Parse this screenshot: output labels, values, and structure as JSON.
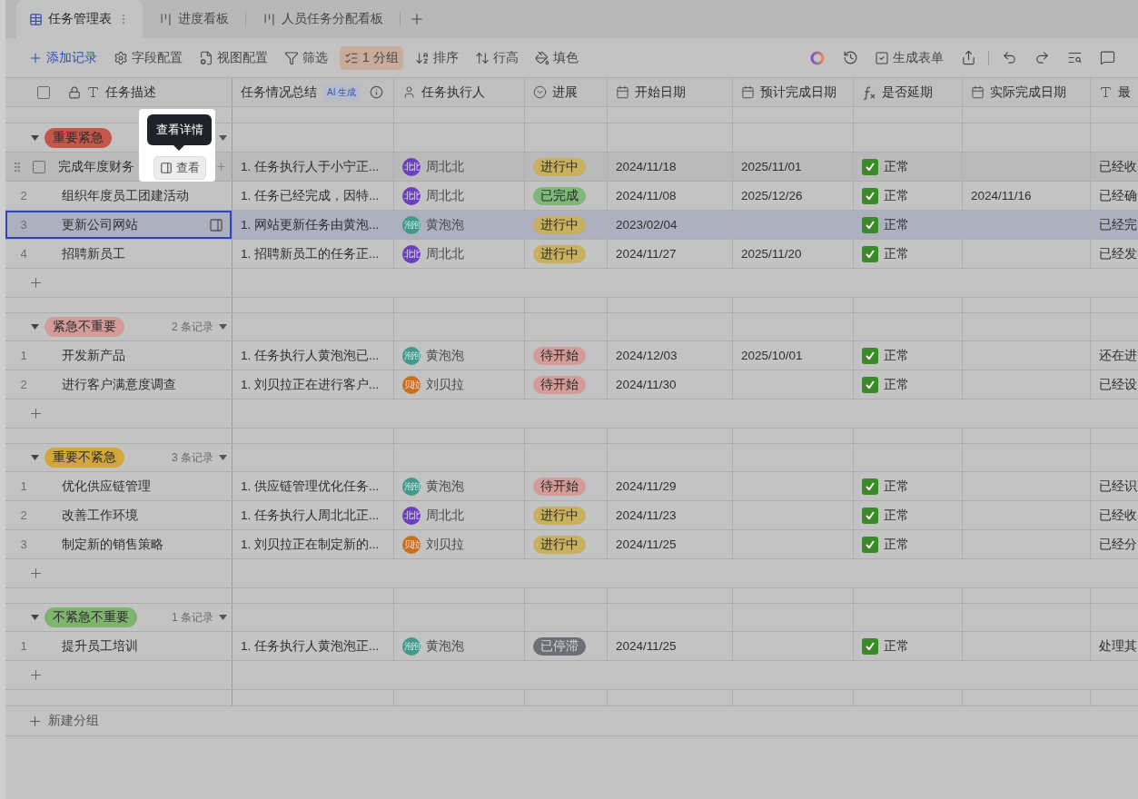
{
  "tabs": [
    {
      "label": "任务管理表",
      "kind": "table",
      "selected": true
    },
    {
      "label": "进度看板",
      "kind": "kanban",
      "selected": false
    },
    {
      "label": "人员任务分配看板",
      "kind": "kanban",
      "selected": false
    }
  ],
  "toolbar": [
    {
      "label": "添加记录",
      "kind": "add",
      "active": false
    },
    {
      "label": "字段配置",
      "kind": "gear",
      "active": false
    },
    {
      "label": "视图配置",
      "kind": "view",
      "active": false
    },
    {
      "label": "筛选",
      "kind": "filter",
      "active": false
    },
    {
      "label": "1 分组",
      "kind": "group",
      "active": true
    },
    {
      "label": "排序",
      "kind": "sort",
      "active": false
    },
    {
      "label": "行高",
      "kind": "height",
      "active": false
    },
    {
      "label": "填色",
      "kind": "paint",
      "active": false
    }
  ],
  "toolbar_right": [
    {
      "kind": "logo"
    },
    {
      "kind": "history"
    },
    {
      "kind": "form",
      "label": "生成表单"
    },
    {
      "kind": "share"
    },
    {
      "kind": "divider"
    },
    {
      "kind": "undo"
    },
    {
      "kind": "redo"
    },
    {
      "kind": "find"
    },
    {
      "kind": "comment"
    }
  ],
  "columns": [
    {
      "label": "任务描述",
      "kind": "text"
    },
    {
      "label": "任务情况总结",
      "kind": "ai",
      "badge": "AI 生成"
    },
    {
      "label": "任务执行人",
      "kind": "person"
    },
    {
      "label": "进展",
      "kind": "select"
    },
    {
      "label": "开始日期",
      "kind": "date"
    },
    {
      "label": "预计完成日期",
      "kind": "date"
    },
    {
      "label": "是否延期",
      "kind": "formula"
    },
    {
      "label": "实际完成日期",
      "kind": "date"
    },
    {
      "label": "最",
      "kind": "text"
    }
  ],
  "select_all": {
    "checked": false
  },
  "tooltip": "查看详情",
  "view_button": "查看",
  "groups": [
    {
      "tag": "重要紧急",
      "color": "#c4574b",
      "rows": [
        {
          "index": null,
          "hovered": true,
          "checked": false,
          "selected": false,
          "name": "完成年度财务",
          "summary": "1. 任务执行人于小宁正...",
          "assignee": {
            "name": "周北北",
            "initials": "北北",
            "color": "#6a3fc0"
          },
          "status": {
            "label": "进行中",
            "color": "#c8b060"
          },
          "start": "2024/11/18",
          "planned": "2025/11/01",
          "delay": "正常",
          "actual": "",
          "latest": "已经收"
        },
        {
          "index": "2",
          "hovered": false,
          "selected": false,
          "name": "组织年度员工团建活动",
          "summary": "1. 任务已经完成，因特...",
          "assignee": {
            "name": "周北北",
            "initials": "北北",
            "color": "#6a3fc0"
          },
          "status": {
            "label": "已完成",
            "color": "#7fb679"
          },
          "start": "2024/11/08",
          "planned": "2025/12/26",
          "delay": "正常",
          "actual": "2024/11/16",
          "latest": "已经确"
        },
        {
          "index": "3",
          "hovered": false,
          "selected": true,
          "name": "更新公司网站",
          "summary": "1. 网站更新任务由黄泡...",
          "assignee": {
            "name": "黄泡泡",
            "initials": "泡泡",
            "color": "#3f9a8c"
          },
          "status": {
            "label": "进行中",
            "color": "#c8b060"
          },
          "start": "2023/02/04",
          "planned": "",
          "delay": "正常",
          "actual": "",
          "latest": "已经完"
        },
        {
          "index": "4",
          "hovered": false,
          "selected": false,
          "name": "招聘新员工",
          "summary": "1. 招聘新员工的任务正...",
          "assignee": {
            "name": "周北北",
            "initials": "北北",
            "color": "#6a3fc0"
          },
          "status": {
            "label": "进行中",
            "color": "#c8b060"
          },
          "start": "2024/11/27",
          "planned": "2025/11/20",
          "delay": "正常",
          "actual": "",
          "latest": "已经发"
        }
      ]
    },
    {
      "tag": "紧急不重要",
      "color": "#d39c99",
      "count": "2 条记录",
      "rows": [
        {
          "index": "1",
          "hovered": false,
          "selected": false,
          "name": "开发新产品",
          "summary": "1. 任务执行人黄泡泡已...",
          "assignee": {
            "name": "黄泡泡",
            "initials": "泡泡",
            "color": "#3f9a8c"
          },
          "status": {
            "label": "待开始",
            "color": "#d39c99"
          },
          "start": "2024/12/03",
          "planned": "2025/10/01",
          "delay": "正常",
          "actual": "",
          "latest": "还在进"
        },
        {
          "index": "2",
          "hovered": false,
          "selected": false,
          "name": "进行客户满意度调查",
          "summary": "1. 刘贝拉正在进行客户...",
          "assignee": {
            "name": "刘贝拉",
            "initials": "贝拉",
            "color": "#c9701f"
          },
          "status": {
            "label": "待开始",
            "color": "#d39c99"
          },
          "start": "2024/11/30",
          "planned": "",
          "delay": "正常",
          "actual": "",
          "latest": "已经设"
        }
      ]
    },
    {
      "tag": "重要不紧急",
      "color": "#d3a63a",
      "count": "3 条记录",
      "rows": [
        {
          "index": "1",
          "hovered": false,
          "selected": false,
          "name": "优化供应链管理",
          "summary": "1. 供应链管理优化任务...",
          "assignee": {
            "name": "黄泡泡",
            "initials": "泡泡",
            "color": "#3f9a8c"
          },
          "status": {
            "label": "待开始",
            "color": "#d39c99"
          },
          "start": "2024/11/29",
          "planned": "",
          "delay": "正常",
          "actual": "",
          "latest": "已经识"
        },
        {
          "index": "2",
          "hovered": false,
          "selected": false,
          "name": "改善工作环境",
          "summary": "1. 任务执行人周北北正...",
          "assignee": {
            "name": "周北北",
            "initials": "北北",
            "color": "#6a3fc0"
          },
          "status": {
            "label": "进行中",
            "color": "#c8b060"
          },
          "start": "2024/11/23",
          "planned": "",
          "delay": "正常",
          "actual": "",
          "latest": "已经收"
        },
        {
          "index": "3",
          "hovered": false,
          "selected": false,
          "name": "制定新的销售策略",
          "summary": "1. 刘贝拉正在制定新的...",
          "assignee": {
            "name": "刘贝拉",
            "initials": "贝拉",
            "color": "#c9701f"
          },
          "status": {
            "label": "进行中",
            "color": "#c8b060"
          },
          "start": "2024/11/25",
          "planned": "",
          "delay": "正常",
          "actual": "",
          "latest": "已经分"
        }
      ]
    },
    {
      "tag": "不紧急不重要",
      "color": "#7db56f",
      "count": "1 条记录",
      "rows": [
        {
          "index": "1",
          "hovered": false,
          "selected": false,
          "name": "提升员工培训",
          "summary": "1. 任务执行人黄泡泡正...",
          "assignee": {
            "name": "黄泡泡",
            "initials": "泡泡",
            "color": "#3f9a8c"
          },
          "status": {
            "label": "已停滞",
            "color": "#6d6f76"
          },
          "start": "2024/11/25",
          "planned": "",
          "delay": "正常",
          "actual": "",
          "latest": "处理其"
        }
      ]
    }
  ],
  "new_group": "新建分组"
}
